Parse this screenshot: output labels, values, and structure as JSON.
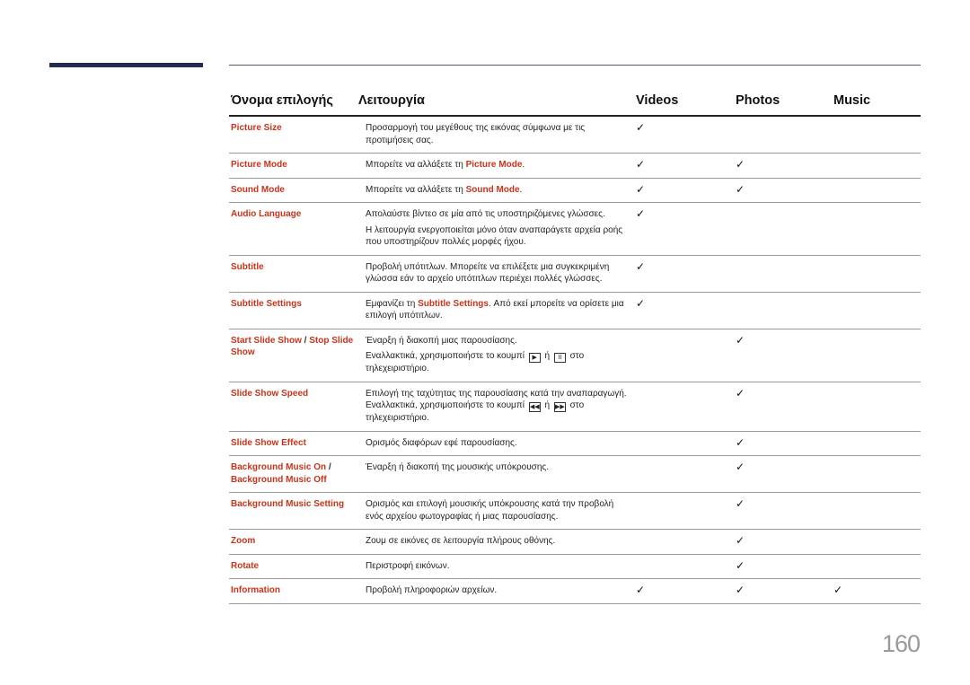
{
  "header": {
    "col_name": "Όνομα επιλογής",
    "col_function": "Λειτουργία",
    "col_videos": "Videos",
    "col_photos": "Photos",
    "col_music": "Music"
  },
  "check_symbol": "✓",
  "rows": [
    {
      "name": "Picture Size",
      "desc": [
        "Προσαρμογή του μεγέθους της εικόνας σύμφωνα με τις προτιμήσεις σας."
      ],
      "videos": true,
      "photos": false,
      "music": false
    },
    {
      "name": "Picture Mode",
      "desc_pre": "Μπορείτε να αλλάξετε τη ",
      "desc_hl": "Picture Mode",
      "desc_post": ".",
      "videos": true,
      "photos": true,
      "music": false
    },
    {
      "name": "Sound Mode",
      "desc_pre": "Μπορείτε να αλλάξετε τη ",
      "desc_hl": "Sound Mode",
      "desc_post": ".",
      "videos": true,
      "photos": true,
      "music": false
    },
    {
      "name": "Audio Language",
      "desc": [
        "Απολαύστε βίντεο σε μία από τις υποστηριζόμενες γλώσσες.",
        "Η λειτουργία ενεργοποιείται μόνο όταν αναπαράγετε αρχεία ροής που υποστηρίζουν πολλές μορφές ήχου."
      ],
      "videos": true,
      "photos": false,
      "music": false
    },
    {
      "name": "Subtitle",
      "desc": [
        "Προβολή υπότιτλων. Μπορείτε να επιλέξετε μια συγκεκριμένη γλώσσα εάν το αρχείο υπότιτλων περιέχει πολλές γλώσσες."
      ],
      "videos": true,
      "photos": false,
      "music": false
    },
    {
      "name": "Subtitle Settings",
      "desc_pre": "Εμφανίζει τη ",
      "desc_hl": "Subtitle Settings",
      "desc_post": ". Από εκεί μπορείτε να ορίσετε μια επιλογή υπότιτλων.",
      "videos": true,
      "photos": false,
      "music": false
    },
    {
      "name_a": "Start Slide Show",
      "name_sep": " / ",
      "name_b": "Stop Slide Show",
      "desc_1": "Έναρξη ή διακοπή μιας παρουσίασης.",
      "desc_2_pre": "Εναλλακτικά, χρησιμοποιήστε το κουμπί ",
      "key_1": "▶",
      "desc_2_mid": " ή ",
      "key_2": "II",
      "desc_2_post": " στο τηλεχειριστήριο.",
      "videos": false,
      "photos": true,
      "music": false
    },
    {
      "name": "Slide Show Speed",
      "desc_pre": "Επιλογή της ταχύτητας της παρουσίασης κατά την αναπαραγωγή. Εναλλακτικά, χρησιμοποιήστε το κουμπί ",
      "key_1": "◀◀",
      "desc_mid": " ή ",
      "key_2": "▶▶",
      "desc_post": " στο τηλεχειριστήριο.",
      "videos": false,
      "photos": true,
      "music": false
    },
    {
      "name": "Slide Show Effect",
      "desc": [
        "Ορισμός διαφόρων εφέ παρουσίασης."
      ],
      "videos": false,
      "photos": true,
      "music": false
    },
    {
      "name_a": "Background Music On",
      "name_sep": " / ",
      "name_b": "Background Music Off",
      "desc": [
        "Έναρξη ή διακοπή της μουσικής υπόκρουσης."
      ],
      "videos": false,
      "photos": true,
      "music": false
    },
    {
      "name": "Background Music Setting",
      "desc": [
        "Ορισμός και επιλογή μουσικής υπόκρουσης κατά την προβολή ενός αρχείου φωτογραφίας ή μιας παρουσίασης."
      ],
      "videos": false,
      "photos": true,
      "music": false
    },
    {
      "name": "Zoom",
      "desc": [
        "Ζουμ σε εικόνες σε λειτουργία πλήρους οθόνης."
      ],
      "videos": false,
      "photos": true,
      "music": false
    },
    {
      "name": "Rotate",
      "desc": [
        "Περιστροφή εικόνων."
      ],
      "videos": false,
      "photos": true,
      "music": false
    },
    {
      "name": "Information",
      "desc": [
        "Προβολή πληροφοριών αρχείων."
      ],
      "videos": true,
      "photos": true,
      "music": true
    }
  ],
  "page_number": "160"
}
